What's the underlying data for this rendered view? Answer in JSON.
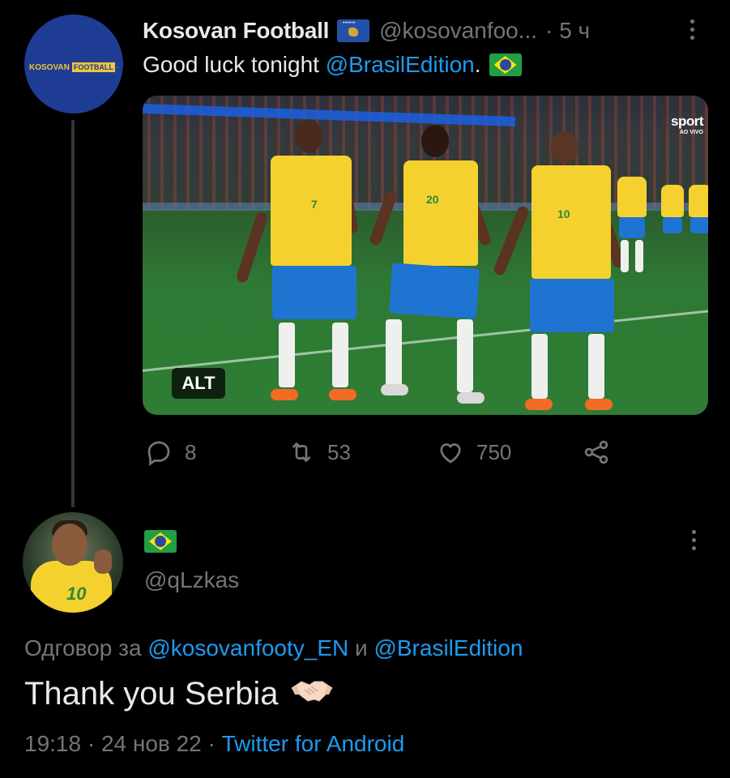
{
  "tweet": {
    "author": {
      "name": "Kosovan Football",
      "handle": "@kosovanfoo...",
      "avatar_text": "KOSOVAN",
      "avatar_badge": "FOOTBALL"
    },
    "time": "· 5 ч",
    "text_before": "Good luck tonight ",
    "mention": "@BrasilEdition",
    "text_after": ".",
    "flag_icon": "brazil-flag",
    "media": {
      "broadcaster_logo": "sport",
      "broadcaster_sub": "AO VIVO",
      "alt_label": "ALT",
      "player_numbers": [
        "7",
        "20",
        "10"
      ]
    },
    "actions": {
      "replies": "8",
      "retweets": "53",
      "likes": "750"
    }
  },
  "reply": {
    "name_icon": "brazil-flag",
    "handle": "@qLzkas",
    "avatar_number": "10",
    "reply_prefix": "Одговор за ",
    "reply_mention_1": "@kosovanfooty_EN",
    "reply_joiner": " и ",
    "reply_mention_2": "@BrasilEdition",
    "text": "Thank you Serbia",
    "emoji": "handshake",
    "time": "19:18",
    "sep1": " · ",
    "date": "24 нов 22",
    "sep2": " · ",
    "source": "Twitter for Android"
  },
  "colors": {
    "background": "#000000",
    "text": "#e7e9ea",
    "secondary": "#71767b",
    "accent": "#1d9bf0"
  }
}
